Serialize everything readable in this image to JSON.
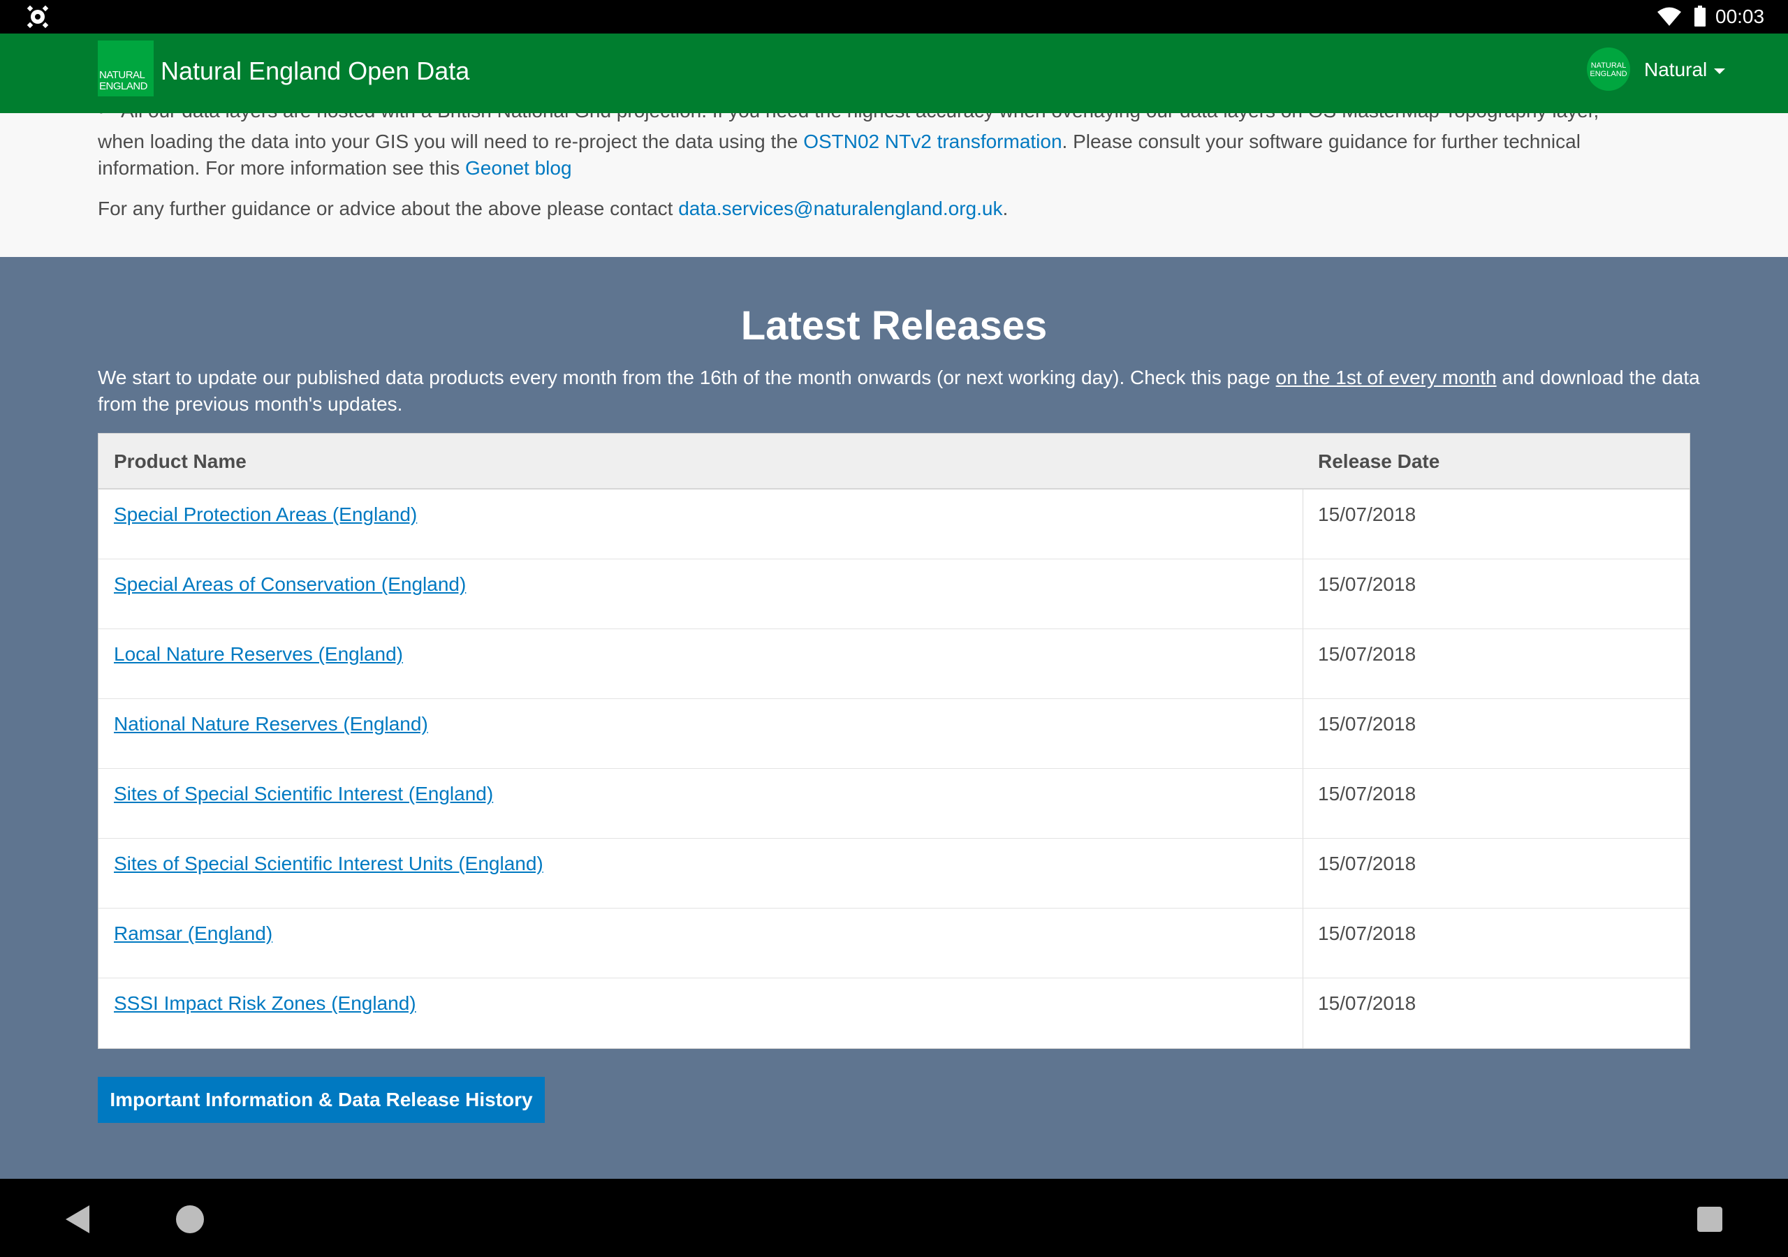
{
  "status_bar": {
    "time": "00:03",
    "app_icon": "settings-bug-icon",
    "wifi_icon": "wifi-icon",
    "battery_icon": "battery-icon"
  },
  "header": {
    "logo_line1": "NATURAL",
    "logo_line2": "ENGLAND",
    "title": "Natural England Open Data",
    "avatar_text": "NATURAL ENGLAND",
    "user_name": "Natural",
    "caret_icon": "caret-down-icon",
    "brand_color": "#007e2f"
  },
  "info": {
    "bullet_text": "All our data layers are hosted with a British National Grid projection. If you need the highest accuracy when overlaying our data layers on OS MasterMap Topography layer,",
    "line2_before": "when loading the data into your GIS you will need to re-project the data using the ",
    "line2_link": "OSTN02 NTv2 transformation",
    "line2_after": ". Please consult your software guidance for further technical",
    "line3_before": "information. For more information see this ",
    "line3_link": "Geonet blog",
    "contact_before": "For any further guidance or advice about the above please contact ",
    "contact_link": "data.services@naturalengland.org.uk",
    "contact_after": "."
  },
  "releases": {
    "title": "Latest Releases",
    "intro_before": "We start to update our published data products every month from the 16th of the month onwards (or next working day). Check this page ",
    "intro_link": "on the 1st of every month",
    "intro_after": " and download the data from the previous month's updates.",
    "columns": [
      "Product Name",
      "Release Date"
    ],
    "rows": [
      {
        "name": "Special Protection Areas (England)",
        "date": "15/07/2018"
      },
      {
        "name": "Special Areas of Conservation (England)",
        "date": "15/07/2018"
      },
      {
        "name": "Local Nature Reserves (England)",
        "date": "15/07/2018"
      },
      {
        "name": "National Nature Reserves (England)",
        "date": "15/07/2018"
      },
      {
        "name": "Sites of Special Scientific Interest (England)",
        "date": "15/07/2018"
      },
      {
        "name": "Sites of Special Scientific Interest Units (England)",
        "date": "15/07/2018"
      },
      {
        "name": "Ramsar (England)",
        "date": "15/07/2018"
      },
      {
        "name": "SSSI Impact Risk Zones (England)",
        "date": "15/07/2018"
      }
    ],
    "history_button": "Important Information & Data Release History",
    "link_color": "#0079c1"
  },
  "nav_bar": {
    "back_icon": "back-triangle-icon",
    "home_icon": "home-circle-icon",
    "recents_icon": "recents-square-icon"
  }
}
